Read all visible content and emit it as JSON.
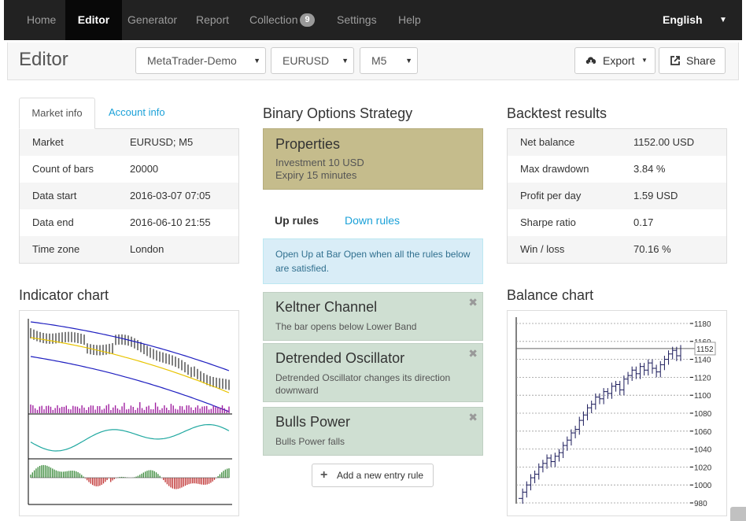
{
  "nav": {
    "items": [
      {
        "label": "Home",
        "name": "nav-home"
      },
      {
        "label": "Editor",
        "name": "nav-editor"
      },
      {
        "label": "Generator",
        "name": "nav-generator"
      },
      {
        "label": "Report",
        "name": "nav-report"
      },
      {
        "label": "Collection",
        "name": "nav-collection"
      },
      {
        "label": "Settings",
        "name": "nav-settings"
      },
      {
        "label": "Help",
        "name": "nav-help"
      }
    ],
    "collection_count": "9",
    "language": "English"
  },
  "header": {
    "title": "Editor",
    "server": "MetaTrader-Demo",
    "symbol": "EURUSD",
    "period": "M5",
    "export_label": "Export",
    "share_label": "Share"
  },
  "market": {
    "tab_active": "Market info",
    "tab_other": "Account info",
    "rows": [
      {
        "k": "Market",
        "v": "EURUSD; M5"
      },
      {
        "k": "Count of bars",
        "v": "20000"
      },
      {
        "k": "Data start",
        "v": "2016-03-07 07:05"
      },
      {
        "k": "Data end",
        "v": "2016-06-10 21:55"
      },
      {
        "k": "Time zone",
        "v": "London"
      }
    ]
  },
  "strategy": {
    "title": "Binary Options Strategy",
    "properties_title": "Properties",
    "investment": "Investment 10 USD",
    "expiry": "Expiry 15 minutes",
    "tab_up": "Up rules",
    "tab_down": "Down rules",
    "info": "Open Up at Bar Open when all the rules below are satisfied.",
    "rules": [
      {
        "title": "Keltner Channel",
        "desc": "The bar opens below Lower Band"
      },
      {
        "title": "Detrended Oscillator",
        "desc": "Detrended Oscillator changes its direction downward"
      },
      {
        "title": "Bulls Power",
        "desc": "Bulls Power falls"
      }
    ],
    "add_label": "Add a new entry rule"
  },
  "backtest": {
    "title": "Backtest results",
    "rows": [
      {
        "k": "Net balance",
        "v": "1152.00 USD"
      },
      {
        "k": "Max drawdown",
        "v": "3.84 %"
      },
      {
        "k": "Profit per day",
        "v": "1.59 USD"
      },
      {
        "k": "Sharpe ratio",
        "v": "0.17"
      },
      {
        "k": "Win / loss",
        "v": "70.16 %"
      }
    ]
  },
  "indicator_chart": {
    "title": "Indicator chart"
  },
  "balance_chart": {
    "title": "Balance chart",
    "current_label": "1152",
    "current": 1152,
    "y_ticks": [
      "1180",
      "1160",
      "1140",
      "1120",
      "1100",
      "1080",
      "1060",
      "1040",
      "1020",
      "1000",
      "980"
    ]
  },
  "chart_data": {
    "type": "line",
    "title": "Balance chart",
    "ylim": [
      980,
      1180
    ],
    "y_ticks": [
      980,
      1000,
      1020,
      1040,
      1060,
      1080,
      1100,
      1120,
      1140,
      1160,
      1180
    ],
    "series": [
      {
        "values": [
          985,
          992,
          1000,
          1008,
          1012,
          1020,
          1024,
          1030,
          1026,
          1032,
          1036,
          1044,
          1050,
          1058,
          1062,
          1072,
          1078,
          1086,
          1090,
          1098,
          1096,
          1104,
          1102,
          1110,
          1112,
          1106,
          1118,
          1122,
          1128,
          1124,
          1132,
          1128,
          1136,
          1130,
          1126,
          1134,
          1140,
          1146,
          1150,
          1144,
          1152
        ]
      }
    ]
  },
  "colors": {
    "navbar": "#222222",
    "link": "#1ba1d8",
    "properties": "#c5bc8c",
    "rule": "#cfdfd2",
    "info": "#d9edf7"
  }
}
